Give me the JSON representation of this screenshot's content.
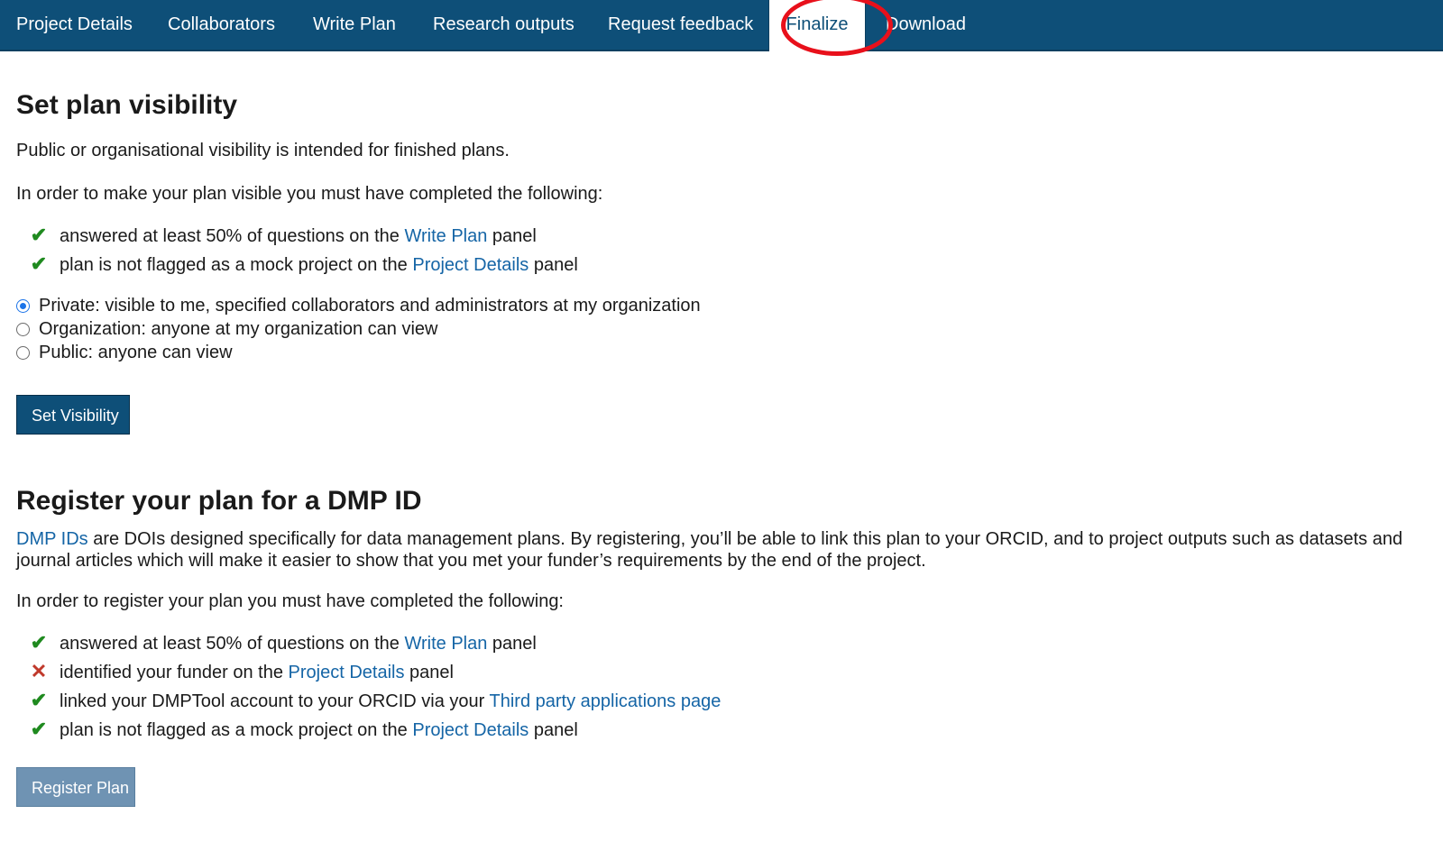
{
  "nav": {
    "tabs": [
      {
        "label": "Project Details"
      },
      {
        "label": "Collaborators"
      },
      {
        "label": "Write Plan"
      },
      {
        "label": "Research outputs"
      },
      {
        "label": "Request feedback"
      },
      {
        "label": "Finalize",
        "active": true
      },
      {
        "label": "Download"
      }
    ]
  },
  "visibility": {
    "heading": "Set plan visibility",
    "intro": "Public or organisational visibility is intended for finished plans.",
    "requirements_intro": "In order to make your plan visible you must have completed the following:",
    "requirements": [
      {
        "status": "ok",
        "before": "answered at least 50% of questions on the ",
        "link": "Write Plan",
        "after": " panel"
      },
      {
        "status": "ok",
        "before": "plan is not flagged as a mock project on the ",
        "link": "Project Details",
        "after": " panel"
      }
    ],
    "options": [
      {
        "label": "Private: visible to me, specified collaborators and administrators at my organization",
        "checked": true
      },
      {
        "label": "Organization: anyone at my organization can view",
        "checked": false
      },
      {
        "label": "Public: anyone can view",
        "checked": false
      }
    ],
    "button": "Set Visibility"
  },
  "register": {
    "heading": "Register your plan for a DMP ID",
    "intro_link": "DMP IDs",
    "intro_text": " are DOIs designed specifically for data management plans. By registering, you’ll be able to link this plan to your ORCID, and to project outputs such as datasets and journal articles which will make it easier to show that you met your funder’s requirements by the end of the project.",
    "requirements_intro": "In order to register your plan you must have completed the following:",
    "requirements": [
      {
        "status": "ok",
        "before": "answered at least 50% of questions on the ",
        "link": "Write Plan",
        "after": " panel"
      },
      {
        "status": "bad",
        "before": "identified your funder on the ",
        "link": "Project Details",
        "after": " panel"
      },
      {
        "status": "ok",
        "before": "linked your DMPTool account to your ORCID via your ",
        "link": "Third party applications page",
        "after": ""
      },
      {
        "status": "ok",
        "before": "plan is not flagged as a mock project on the ",
        "link": "Project Details",
        "after": " panel"
      }
    ],
    "button": "Register Plan"
  },
  "icons": {
    "ok": "check-icon",
    "bad": "cross-icon"
  },
  "colors": {
    "nav": "#0e4f78",
    "link": "#1565a6",
    "ok": "#1f8a1f",
    "bad": "#c0392b",
    "highlight": "#e8101b"
  }
}
